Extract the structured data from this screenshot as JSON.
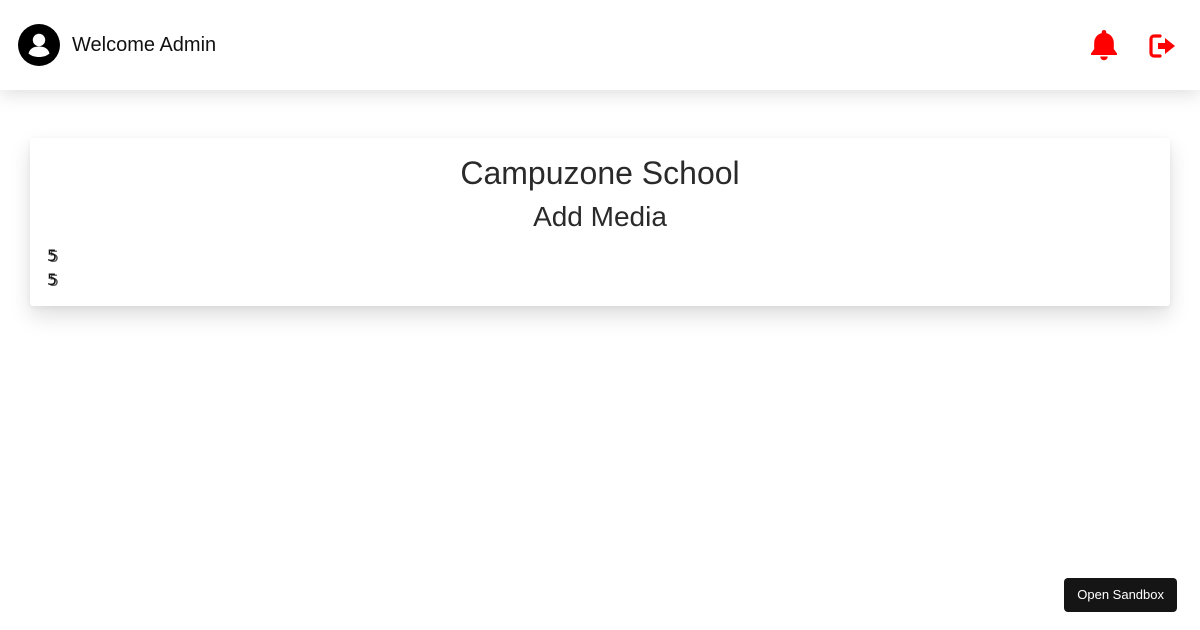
{
  "header": {
    "welcome": "Welcome Admin",
    "avatar_icon": "user-circle-icon",
    "notification_icon": "bell-icon",
    "logout_icon": "sign-out-icon",
    "accent_color": "#ff0000"
  },
  "card": {
    "school_name": "Campuzone School",
    "page_title": "Add Media",
    "glyphs": [
      "5",
      "5"
    ]
  },
  "sandbox": {
    "label": "Open Sandbox"
  }
}
